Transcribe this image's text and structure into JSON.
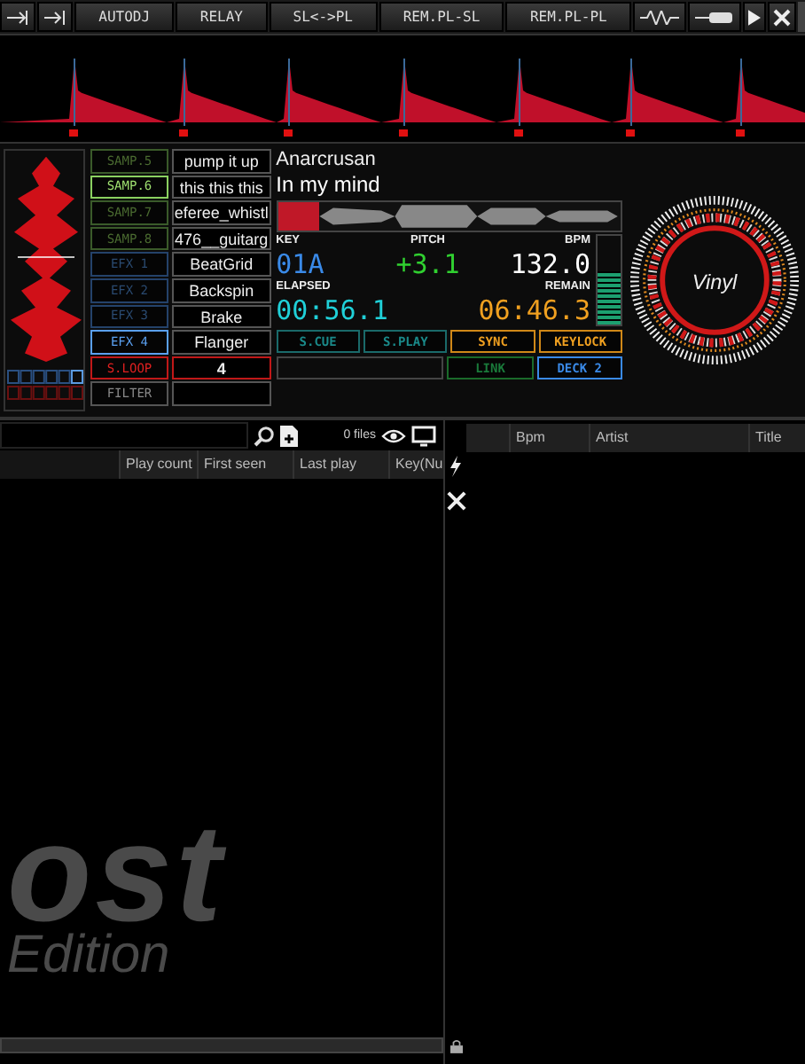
{
  "toolbar": {
    "buttons": [
      "AUTODJ",
      "RELAY",
      "SL<->PL",
      "REM.PL-SL",
      "REM.PL-PL"
    ]
  },
  "deck": {
    "samplers": [
      {
        "label": "SAMP.5",
        "name": "pump it up",
        "selected": false
      },
      {
        "label": "SAMP.6",
        "name": "this this this",
        "selected": true
      },
      {
        "label": "SAMP.7",
        "name": "eferee_whistl",
        "selected": false
      },
      {
        "label": "SAMP.8",
        "name": "476__guitarg",
        "selected": false
      }
    ],
    "effects": [
      {
        "label": "EFX 1",
        "name": "BeatGrid",
        "selected": false
      },
      {
        "label": "EFX 2",
        "name": "Backspin",
        "selected": false
      },
      {
        "label": "EFX 3",
        "name": "Brake",
        "selected": false
      },
      {
        "label": "EFX 4",
        "name": "Flanger",
        "selected": true
      }
    ],
    "loop": {
      "label": "S.LOOP",
      "value": "4"
    },
    "filter": {
      "label": "FILTER"
    },
    "artist": "Anarcrusan",
    "title": "In my mind",
    "position": {
      "level": 0.12
    },
    "key": {
      "label": "KEY",
      "value": "01A"
    },
    "pitch": {
      "label": "PITCH",
      "value": "+3.1"
    },
    "bpm": {
      "label": "BPM",
      "value": "132.0"
    },
    "elapsed": {
      "label": "ELAPSED",
      "value": "00:56.1"
    },
    "remain": {
      "label": "REMAIN",
      "value": "06:46.3"
    },
    "meter": {
      "level": 0.6
    },
    "buttons": [
      {
        "label": "S.CUE",
        "kind": "teal"
      },
      {
        "label": "S.PLAY",
        "kind": "teal"
      },
      {
        "label": "SYNC",
        "kind": "orange"
      },
      {
        "label": "KEYLOCK",
        "kind": "orange"
      }
    ],
    "buttons_2": [
      {
        "label": "LINK",
        "kind": "green"
      },
      {
        "label": "DECK 2",
        "kind": "blue"
      }
    ],
    "platter": {
      "label": "Vinyl"
    }
  },
  "browser": {
    "file_count": "0 files",
    "columns": [
      "Play count",
      "First seen",
      "Last play",
      "Key(Nu"
    ],
    "side_columns": [
      "Bpm",
      "Artist",
      "Title"
    ],
    "logo": {
      "word": "ost",
      "subtitle": "Edition"
    }
  }
}
